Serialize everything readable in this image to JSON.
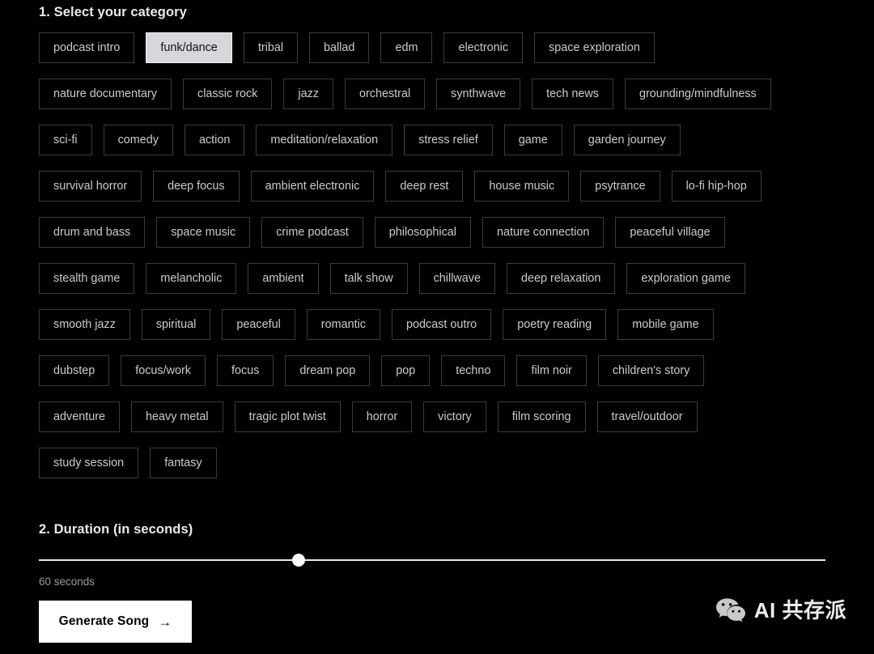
{
  "category_section": {
    "title": "1. Select your category",
    "selected": "funk/dance",
    "rows": [
      [
        "podcast intro",
        "funk/dance",
        "tribal",
        "ballad",
        "edm",
        "electronic",
        "space exploration"
      ],
      [
        "nature documentary",
        "classic rock",
        "jazz",
        "orchestral",
        "synthwave",
        "tech news",
        "grounding/mindfulness"
      ],
      [
        "sci-fi",
        "comedy",
        "action",
        "meditation/relaxation",
        "stress relief",
        "game",
        "garden journey"
      ],
      [
        "survival horror",
        "deep focus",
        "ambient electronic",
        "deep rest",
        "house music",
        "psytrance",
        "lo-fi hip-hop"
      ],
      [
        "drum and bass",
        "space music",
        "crime podcast",
        "philosophical",
        "nature connection",
        "peaceful village"
      ],
      [
        "stealth game",
        "melancholic",
        "ambient",
        "talk show",
        "chillwave",
        "deep relaxation",
        "exploration game"
      ],
      [
        "smooth jazz",
        "spiritual",
        "peaceful",
        "romantic",
        "podcast outro",
        "poetry reading",
        "mobile game"
      ],
      [
        "dubstep",
        "focus/work",
        "focus",
        "dream pop",
        "pop",
        "techno",
        "film noir",
        "children's story"
      ],
      [
        "adventure",
        "heavy metal",
        "tragic plot twist",
        "horror",
        "victory",
        "film scoring",
        "travel/outdoor"
      ],
      [
        "study session",
        "fantasy"
      ]
    ]
  },
  "duration_section": {
    "title": "2. Duration (in seconds)",
    "value_label": "60 seconds",
    "value": 60,
    "min": 10,
    "max": 180,
    "thumb_percent": 32.6
  },
  "actions": {
    "generate_label": "Generate Song",
    "arrow_glyph": "→"
  },
  "watermark": {
    "text": "AI 共存派",
    "icon": "wechat-icon"
  },
  "colors": {
    "background": "#000000",
    "chip_border": "#3a3c40",
    "chip_text": "#c9cbd1",
    "chip_selected_bg": "#d5d7da",
    "chip_selected_text": "#111214",
    "heading_text": "#e9eaec",
    "muted_text": "#9a9ca2",
    "accent_button_bg": "#ffffff",
    "slider_track": "#e9e9eb"
  }
}
